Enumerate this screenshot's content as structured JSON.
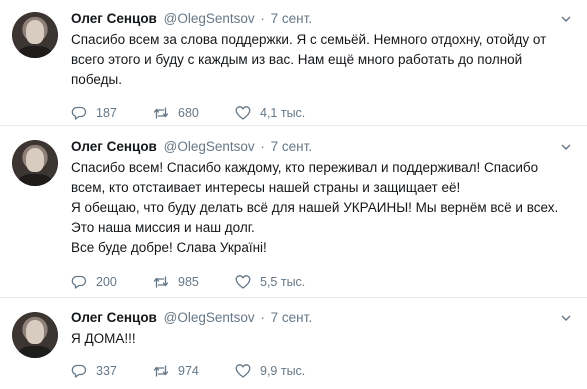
{
  "tweets": [
    {
      "name": "Олег Сенцов",
      "handle": "@OlegSentsov",
      "separator": "·",
      "time": "7 сент.",
      "lines": [
        "Спасибо всем за слова поддержки. Я с семьёй. Немного отдохну, отойду от",
        "всего этого и буду с каждым из вас. Нам ещё много работать до полной",
        "победы."
      ],
      "replies": "187",
      "retweets": "680",
      "likes": "4,1 тыс."
    },
    {
      "name": "Олег Сенцов",
      "handle": "@OlegSentsov",
      "separator": "·",
      "time": "7 сент.",
      "lines": [
        "Спасибо всем! Спасибо каждому, кто переживал и поддерживал! Спасибо",
        "всем, кто отстаивает интересы нашей страны и защищает её!",
        "Я обещаю, что буду делать всё для нашей УКРАИНЫ! Мы вернём всё и всех.",
        "Это наша миссия и наш долг.",
        "Все буде добре! Слава Україні!"
      ],
      "replies": "200",
      "retweets": "985",
      "likes": "5,5 тыс."
    },
    {
      "name": "Олег Сенцов",
      "handle": "@OlegSentsov",
      "separator": "·",
      "time": "7 сент.",
      "lines": [
        "Я ДОМА!!!"
      ],
      "replies": "337",
      "retweets": "974",
      "likes": "9,9 тыс."
    }
  ],
  "colors": {
    "text": "#14171a",
    "secondary": "#657786",
    "divider": "#e6ecf0"
  },
  "icons": [
    "avatar",
    "chevron-down-icon",
    "reply-icon",
    "retweet-icon",
    "like-icon"
  ]
}
